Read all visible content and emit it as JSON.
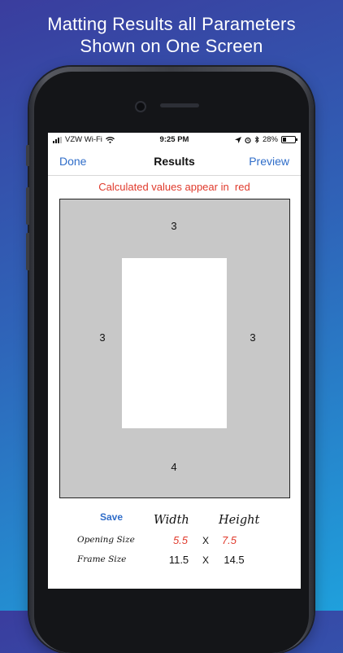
{
  "promo": {
    "line1": "Matting Results all Parameters",
    "line2": "Shown on One Screen"
  },
  "status_bar": {
    "carrier": "VZW Wi-Fi",
    "time": "9:25 PM",
    "battery": "28%",
    "battery_level": 0.28
  },
  "nav": {
    "left": "Done",
    "title": "Results",
    "right": "Preview"
  },
  "hint": "Calculated values appear in  red",
  "mat": {
    "top": "3",
    "left": "3",
    "right": "3",
    "bottom": "4"
  },
  "results": {
    "save_label": "Save",
    "width_header": "Width",
    "height_header": "Height",
    "times": "X",
    "rows": [
      {
        "label": "Opening Size",
        "width": "5.5",
        "height": "7.5"
      },
      {
        "label": "Frame Size",
        "width": "11.5",
        "height": "14.5"
      }
    ]
  },
  "colors": {
    "accent": "#2f6dc9",
    "calculated": "#e03a2c",
    "mat": "#c8c8c8"
  }
}
